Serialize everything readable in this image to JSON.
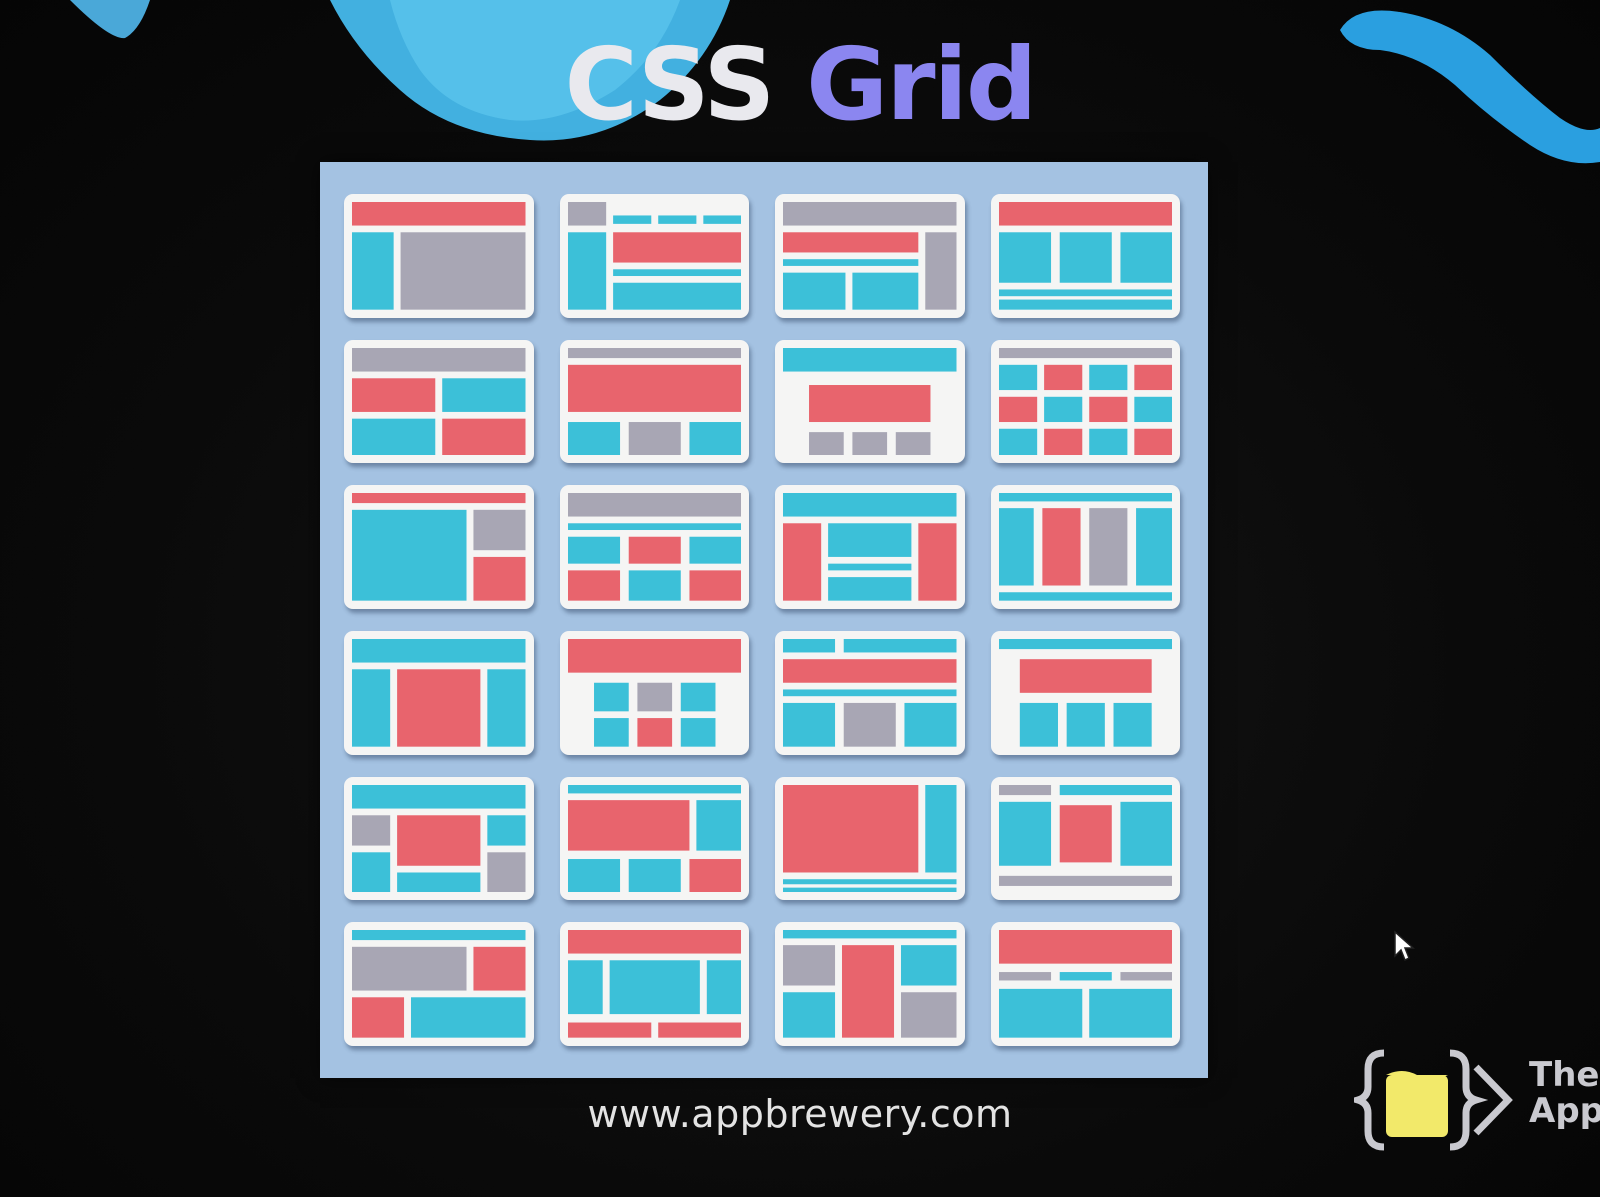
{
  "slide": {
    "title_part1": "CSS",
    "title_part2": "Grid",
    "url": "www.appbrewery.com",
    "brand_line1": "The",
    "brand_line2": "App"
  },
  "colors": {
    "red": "#e8646d",
    "blue": "#3cc0d8",
    "gray": "#a8a6b4",
    "panel": "#a4c2e2",
    "card": "#f5f5f4",
    "title_white": "#e9e9ee",
    "title_purple": "#8b86f0",
    "deco_blue": "#2a9fe0"
  },
  "icons": [
    "mouse-cursor-icon",
    "app-brewery-logo-icon"
  ]
}
